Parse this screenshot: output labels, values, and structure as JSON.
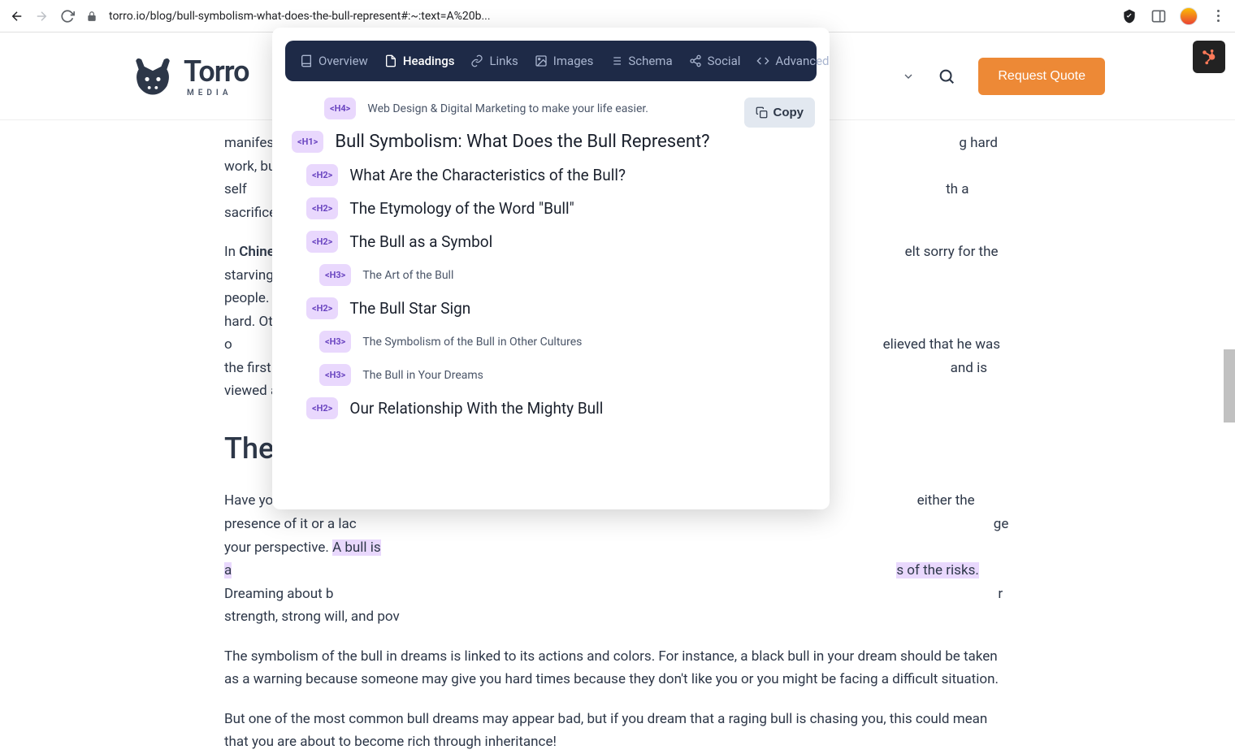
{
  "browser": {
    "url": "torro.io/blog/bull-symbolism-what-does-the-bull-represent#:~:text=A%20b..."
  },
  "site": {
    "logo_text": "Torro",
    "logo_sub": "MEDIA",
    "quote_label": "Request Quote"
  },
  "article": {
    "p1a": "manifes",
    "p1b": "g hard work, burdens, and self",
    "p1c": "th a sacrifice. The bull symboli",
    "p2a": "In ",
    "p2bold": "Chine",
    "p2b": "elt sorry for the starving people.",
    "p2c": " hard. Other myths speak o",
    "p2d": "elieved that he was the first wh",
    "p2e": "and is viewed as the token o",
    "h2": "The",
    "p3a": "Have yo",
    "p3b": "either the presence of it or a lac",
    "p3c": "ge your perspective. ",
    "p3hl1": "A bull is a",
    "p3hl2": "s of the risks.",
    "p3d": " Dreaming about b",
    "p3e": "r strength, strong will, and pov",
    "p4": "The symbolism of the bull in dreams is linked to its actions and colors. For instance, a black bull in your dream should be taken as a warning because someone may give you hard times because they don't like you or you might be facing a difficult situation.",
    "p5": "But one of the most common bull dreams may appear bad, but if you dream that a raging bull is chasing you, this could mean that you are about to become rich through inheritance!"
  },
  "ext": {
    "tabs": {
      "overview": "Overview",
      "headings": "Headings",
      "links": "Links",
      "images": "Images",
      "schema": "Schema",
      "social": "Social",
      "advanced": "Advanced"
    },
    "copy_label": "Copy",
    "headings": [
      {
        "level": "H4",
        "indent": 4,
        "text": "Web Design & Digital Marketing to make your life easier.",
        "cls": "h4-text"
      },
      {
        "level": "H1",
        "indent": 1,
        "text": "Bull Symbolism: What Does the Bull Represent?",
        "cls": "h1-text"
      },
      {
        "level": "H2",
        "indent": 2,
        "text": "What Are the Characteristics of the Bull?",
        "cls": "h2-text"
      },
      {
        "level": "H2",
        "indent": 2,
        "text": "The Etymology of the Word \"Bull\"",
        "cls": "h2-text"
      },
      {
        "level": "H2",
        "indent": 2,
        "text": "The Bull as a Symbol",
        "cls": "h2-text"
      },
      {
        "level": "H3",
        "indent": 3,
        "text": "The Art of the Bull",
        "cls": "h3-text"
      },
      {
        "level": "H2",
        "indent": 2,
        "text": "The Bull Star Sign",
        "cls": "h2-text"
      },
      {
        "level": "H3",
        "indent": 3,
        "text": "The Symbolism of the Bull in Other Cultures",
        "cls": "h3-text"
      },
      {
        "level": "H3",
        "indent": 3,
        "text": "The Bull in Your Dreams",
        "cls": "h3-text"
      },
      {
        "level": "H2",
        "indent": 2,
        "text": "Our Relationship With the Mighty Bull",
        "cls": "h2-text"
      }
    ]
  }
}
